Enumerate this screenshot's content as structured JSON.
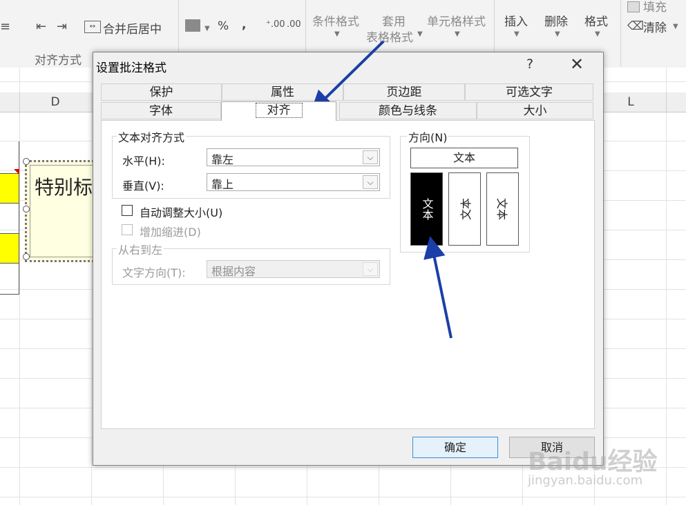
{
  "ribbon": {
    "merge_center": "合并后居中",
    "percent": "%",
    "comma": ",",
    "conditional_format": "条件格式",
    "apply": "套用",
    "table_format": "表格格式",
    "cell_style": "单元格样式",
    "insert": "插入",
    "delete": "删除",
    "format": "格式",
    "fill": "填充",
    "clear": "清除",
    "group_alignment": "对齐方式"
  },
  "sheet": {
    "col_d": "D",
    "col_l": "L",
    "highlight_color": "#ffff00"
  },
  "comment": {
    "text": "特别标"
  },
  "dialog": {
    "title": "设置批注格式",
    "help": "?",
    "close": "✕",
    "tabs_row1": [
      "保护",
      "属性",
      "页边距",
      "可选文字"
    ],
    "tabs_row2": [
      "字体",
      "对齐",
      "颜色与线条",
      "大小"
    ],
    "active_tab": "对齐",
    "text_align_group": "文本对齐方式",
    "horizontal_label": "水平(H):",
    "horizontal_value": "靠左",
    "vertical_label": "垂直(V):",
    "vertical_value": "靠上",
    "auto_size": "自动调整大小(U)",
    "add_indent": "增加缩进(D)",
    "rtl_group": "从右到左",
    "text_direction_label": "文字方向(T):",
    "text_direction_value": "根据内容",
    "orientation_group": "方向(N)",
    "orientation_text": "文本",
    "ok": "确定",
    "cancel": "取消"
  },
  "watermark": {
    "brand": "Baidu经验",
    "url": "jingyan.baidu.com"
  },
  "colors": {
    "arrow": "#1a3fa8",
    "accent": "#3a8fd7"
  }
}
